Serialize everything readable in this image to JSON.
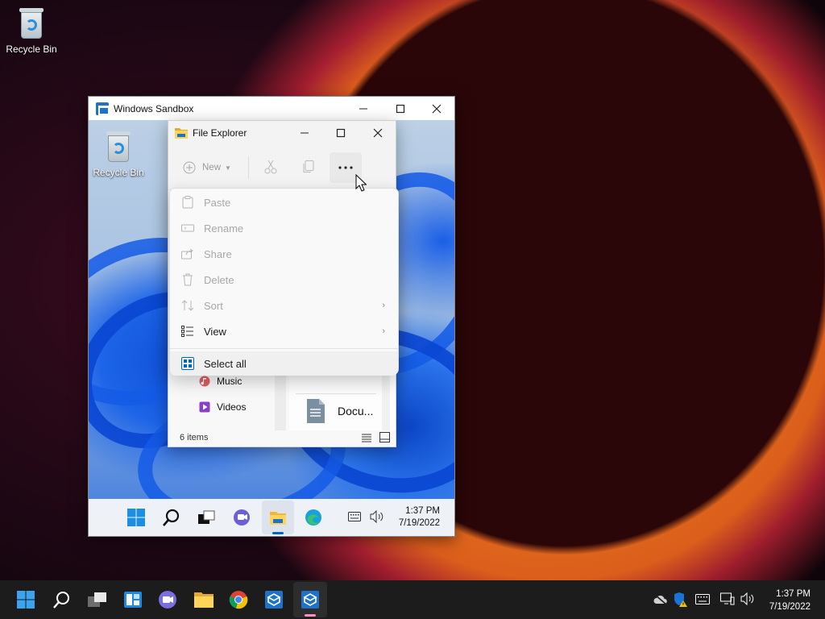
{
  "desktop": {
    "recycle_bin_label": "Recycle Bin"
  },
  "sandbox": {
    "title": "Windows Sandbox",
    "recycle_bin_label": "Recycle Bin",
    "clock": {
      "time": "1:37 PM",
      "date": "7/19/2022"
    }
  },
  "explorer": {
    "title": "File Explorer",
    "new_label": "New",
    "nav_items": [
      "Music",
      "Videos"
    ],
    "file_item": "Docu...",
    "status": "6 items"
  },
  "context_menu": {
    "items": [
      {
        "label": "Paste",
        "icon": "paste-icon",
        "enabled": false
      },
      {
        "label": "Rename",
        "icon": "rename-icon",
        "enabled": false
      },
      {
        "label": "Share",
        "icon": "share-icon",
        "enabled": false
      },
      {
        "label": "Delete",
        "icon": "trash-icon",
        "enabled": false
      },
      {
        "label": "Sort",
        "icon": "sort-icon",
        "enabled": false,
        "submenu": true
      },
      {
        "label": "View",
        "icon": "view-icon",
        "enabled": true,
        "submenu": true
      },
      {
        "label": "Select all",
        "icon": "select-all-icon",
        "enabled": true
      }
    ]
  },
  "taskbar": {
    "clock": {
      "time": "1:37 PM",
      "date": "7/19/2022"
    }
  },
  "colors": {
    "accent": "#0067c0",
    "taskbar": "#1c1c1c"
  }
}
